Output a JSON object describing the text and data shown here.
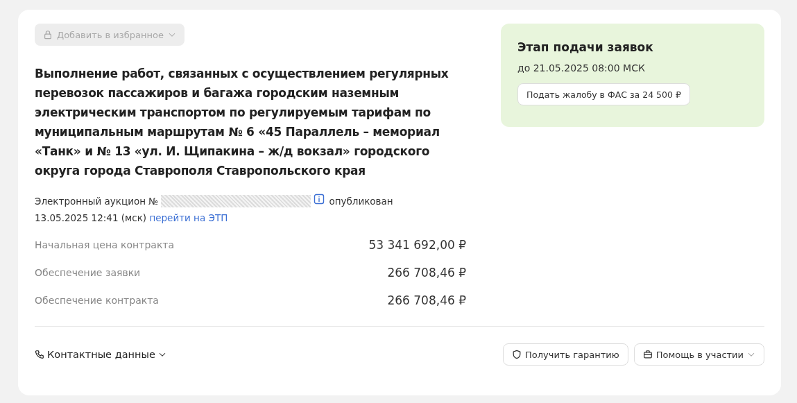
{
  "favorite_button": {
    "label": "Добавить в избранное",
    "disabled": true
  },
  "title": "Выполнение работ, связанных с осуществлением регулярных перевозок пассажиров и багажа городским наземным электрическим транспортом по регулируемым тарифам по муниципальным маршрутам № 6 «45 Параллель – мемориал «Танк» и № 13 «ул. И. Щипакина – ж/д вокзал» городского округа города Ставрополя Ставропольского края",
  "notice": {
    "prefix": "Электронный аукцион №",
    "suffix": "опубликован",
    "date": "13.05.2025 12:41 (мск)",
    "link": "перейти на ЭТП"
  },
  "prices": [
    {
      "label": "Начальная цена контракта",
      "value": "53 341 692,00 ₽"
    },
    {
      "label": "Обеспечение заявки",
      "value": "266 708,46 ₽"
    },
    {
      "label": "Обеспечение контракта",
      "value": "266 708,46 ₽"
    }
  ],
  "contacts": {
    "label": "Контактные данные",
    "expanded": false
  },
  "actions": [
    {
      "label": "Получить гарантию",
      "kind": "guarantee"
    },
    {
      "label": "Помощь в участии",
      "kind": "help"
    }
  ],
  "stage": {
    "title": "Этап подачи заявок",
    "deadline": "до 21.05.2025 08:00 МСК",
    "button": "Подать жалобу в ФАС за 24 500 ₽"
  }
}
